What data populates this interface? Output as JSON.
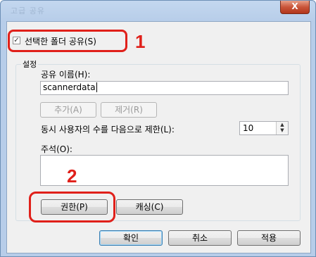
{
  "window": {
    "title": "고급 공유",
    "close_label": "X"
  },
  "share_checkbox": {
    "label": "선택한 폴더 공유(S)",
    "checked": true
  },
  "settings_group": {
    "title": "설정"
  },
  "share_name": {
    "label": "공유 이름(H):",
    "value": "scannerdata"
  },
  "buttons": {
    "add": "추가(A)",
    "remove": "제거(R)",
    "permissions": "권한(P)",
    "caching": "캐싱(C)",
    "ok": "확인",
    "cancel": "취소",
    "apply": "적용"
  },
  "user_limit": {
    "label": "동시 사용자의 수를 다음으로 제한(L):",
    "value": "10"
  },
  "comment": {
    "label": "주석(O):",
    "value": ""
  },
  "callouts": {
    "step1": "1",
    "step2": "2"
  },
  "colors": {
    "highlight": "#e0201a",
    "title_bar": "#b7cde9",
    "close_button": "#c9553a"
  }
}
